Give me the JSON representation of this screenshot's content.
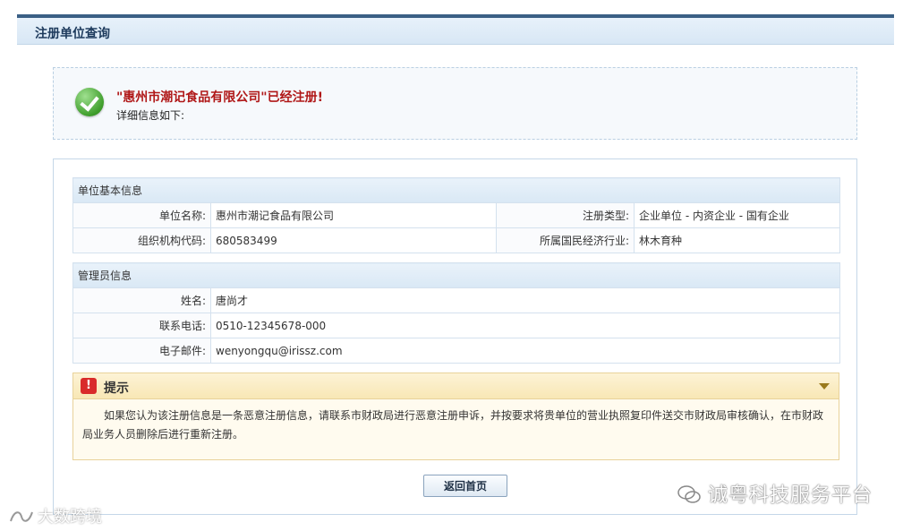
{
  "page": {
    "title": "注册单位查询"
  },
  "result": {
    "headline": "\"惠州市潮记食品有限公司\"已经注册!",
    "subtext": "详细信息如下:"
  },
  "basic_info": {
    "section_title": "单位基本信息",
    "rows": [
      {
        "label1": "单位名称:",
        "value1": "惠州市潮记食品有限公司",
        "label2": "注册类型:",
        "value2": "企业单位 - 内资企业 - 国有企业"
      },
      {
        "label1": "组织机构代码:",
        "value1": "680583499",
        "label2": "所属国民经济行业:",
        "value2": "林木育种"
      }
    ]
  },
  "admin_info": {
    "section_title": "管理员信息",
    "rows": [
      {
        "label": "姓名:",
        "value": "唐尚才"
      },
      {
        "label": "联系电话:",
        "value": "0510-12345678-000"
      },
      {
        "label": "电子邮件:",
        "value": "wenyongqu@irissz.com"
      }
    ]
  },
  "tip": {
    "icon_text": "!",
    "title": "提示",
    "body": "如果您认为该注册信息是一条恶意注册信息，请联系市财政局进行恶意注册申诉，并按要求将贵单位的营业执照复印件送交市财政局审核确认，在市财政局业务人员删除后进行重新注册。"
  },
  "buttons": {
    "back": "返回首页"
  },
  "watermarks": {
    "right": "诚粤科技服务平台",
    "left": "大数跨境"
  },
  "colors": {
    "headline": "#b01818",
    "accent": "#3a5f85",
    "success": "#3f9e2c",
    "tip_icon": "#d92b2b"
  }
}
